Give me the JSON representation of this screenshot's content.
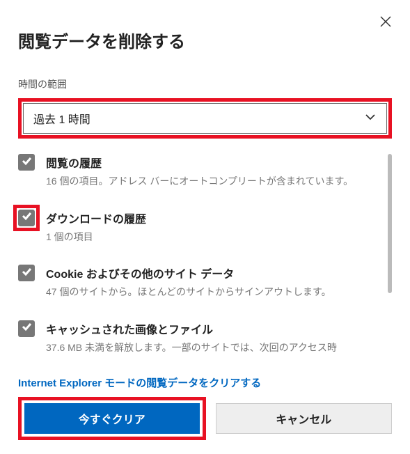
{
  "title": "閲覧データを削除する",
  "timeRangeLabel": "時間の範囲",
  "timeRangeValue": "過去 1 時間",
  "items": [
    {
      "title": "閲覧の履歴",
      "desc": "16 個の項目。アドレス バーにオートコンプリートが含まれています。"
    },
    {
      "title": "ダウンロードの履歴",
      "desc": "1 個の項目"
    },
    {
      "title": "Cookie およびその他のサイト データ",
      "desc": "47 個のサイトから。ほとんどのサイトからサインアウトします。"
    },
    {
      "title": "キャッシュされた画像とファイル",
      "desc": "37.6 MB 未満を解放します。一部のサイトでは、次回のアクセス時"
    }
  ],
  "linkText": "Internet Explorer モードの閲覧データをクリアする",
  "primaryBtn": "今すぐクリア",
  "secondaryBtn": "キャンセル"
}
